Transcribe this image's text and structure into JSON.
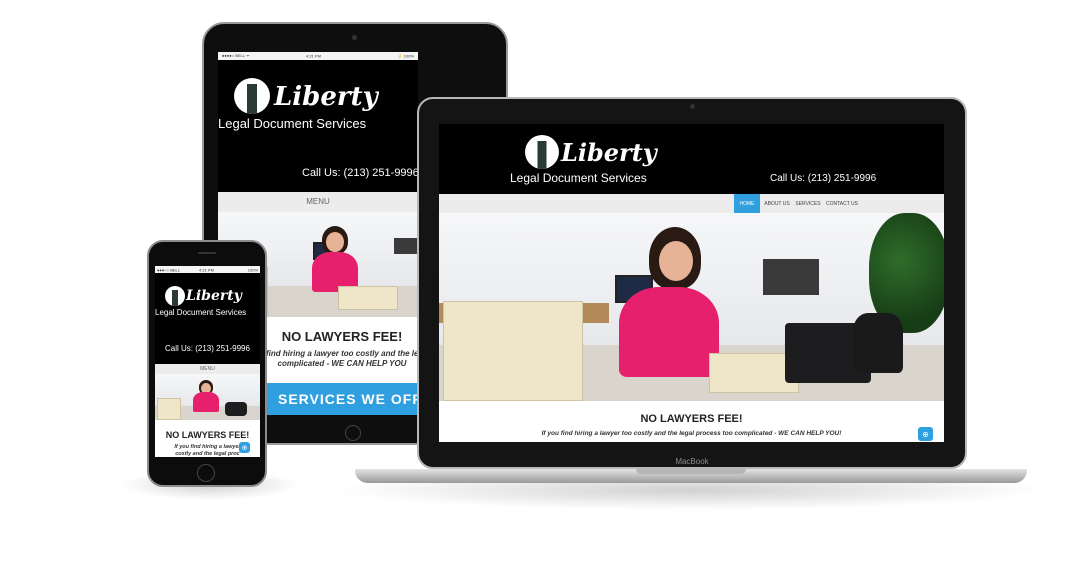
{
  "site": {
    "logo_word": "Liberty",
    "logo_sub": "Legal Document Services",
    "call": "Call Us: (213) 251-9996",
    "nav": [
      "HOME",
      "ABOUT US",
      "SERVICES",
      "CONTACT US"
    ],
    "menu": "MENU",
    "hero_title": "NO LAWYERS FEE!",
    "hero_sub": "If you find hiring a lawyer too costly and the legal process too complicated -  WE CAN HELP YOU!",
    "ipad_sub_line1": "find hiring a lawyer too costly and the legal",
    "ipad_sub_line2": "complicated -  WE CAN HELP YOU",
    "iphone_sub_line1": "If you find hiring a lawyer",
    "iphone_sub_line2": "costly and the legal proc",
    "services_banner": "SERVICES WE OFFER",
    "accent_color": "#2f9fdf"
  },
  "macbook": {
    "label": "MacBook"
  },
  "ipad_status": {
    "carrier": "●●●●○ BELL ᯤ",
    "time": "4:21 PM",
    "battery": "⚡ 100%"
  },
  "iphone_status": {
    "carrier": "●●●○○ BELL",
    "time": "4:21 PM",
    "battery": "100%"
  },
  "icons": {
    "fab": "arrow-up-icon"
  }
}
